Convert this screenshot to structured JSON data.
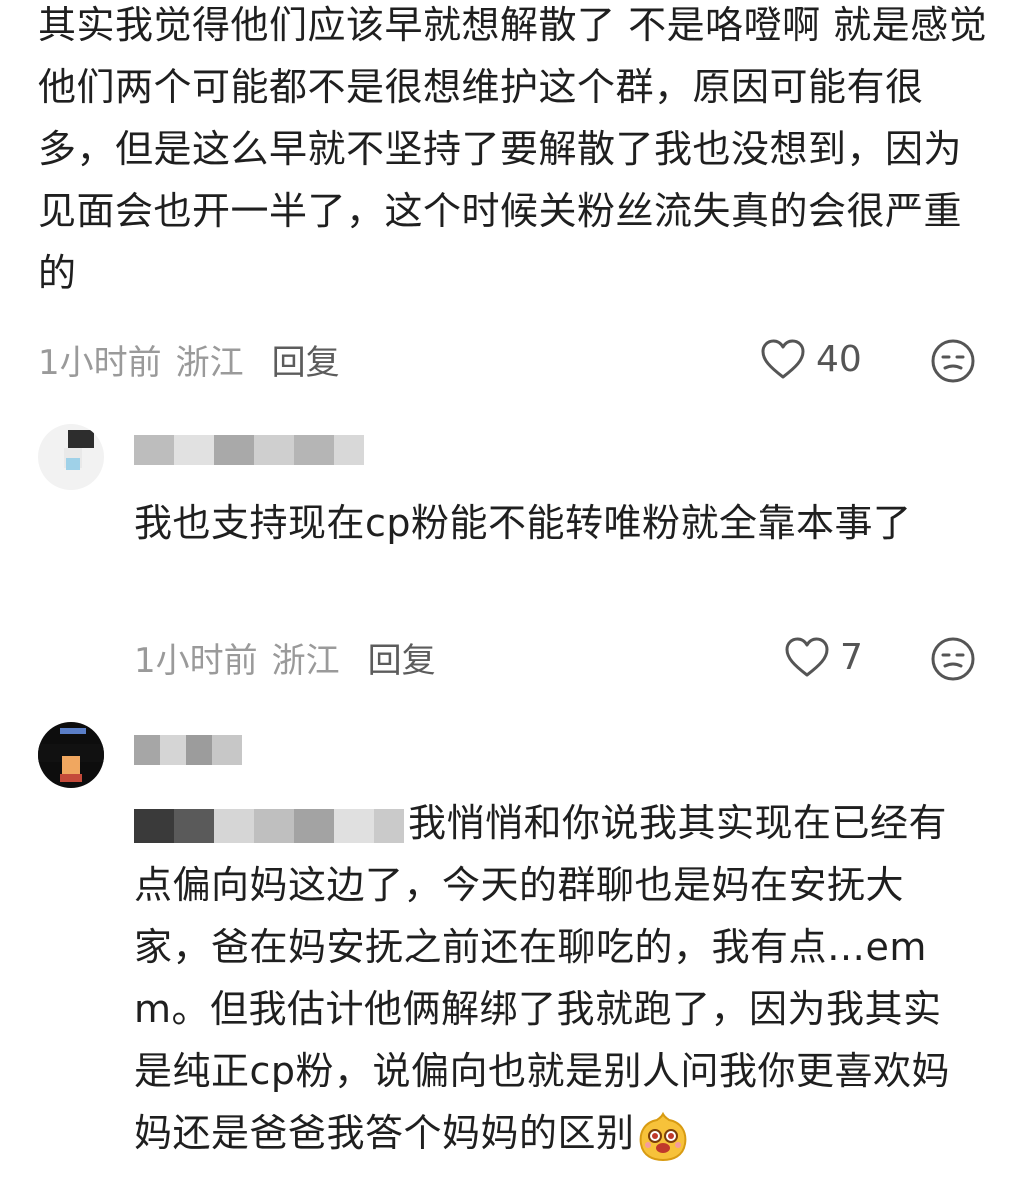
{
  "main_comment": {
    "text": "其实我觉得他们应该早就想解散了 不是咯噔啊 就是感觉他们两个可能都不是很想维护这个群，原因可能有很多，但是这么早就不坚持了要解散了我也没想到，因为见面会也开一半了，这个时候关粉丝流失真的会很严重的",
    "time": "1小时前",
    "location": "浙江",
    "reply_label": "回复",
    "likes": "40"
  },
  "replies": [
    {
      "text": "我也支持现在cp粉能不能转唯粉就全靠本事了",
      "time": "1小时前",
      "location": "浙江",
      "reply_label": "回复",
      "likes": "7"
    },
    {
      "text": "我悄悄和你说我其实现在已经有点偏向妈这边了，今天的群聊也是妈在安抚大家，爸在妈安抚之前还在聊吃的，我有点…emm。但我估计他俩解绑了我就跑了，因为我其实是纯正cp粉，说偏向也就是别人问我你更喜欢妈妈还是爸爸我答个妈妈的区别"
    }
  ],
  "icons": {
    "like": "heart-outline-icon",
    "emoji": "smirk-face-icon",
    "sticker": "laughing-face-sticker-icon"
  }
}
